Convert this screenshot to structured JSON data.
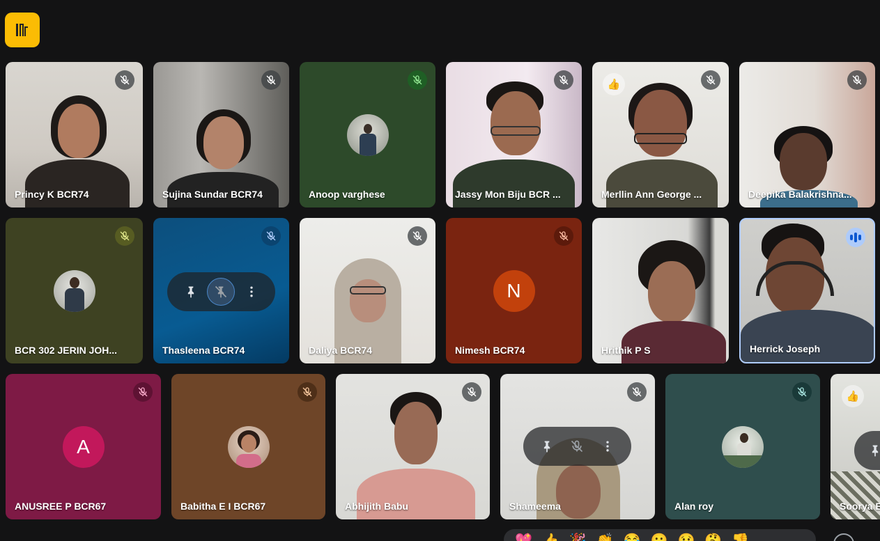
{
  "participants": [
    {
      "name": "Princy K BCR74"
    },
    {
      "name": "Sujina Sundar BCR74"
    },
    {
      "name": "Anoop varghese"
    },
    {
      "name": "Jassy Mon Biju BCR ..."
    },
    {
      "name": "Merllin Ann George ..."
    },
    {
      "name": "Deepika Balakrishna..."
    },
    {
      "name": "BCR 302 JERIN JOH..."
    },
    {
      "name": "Thasleena BCR74"
    },
    {
      "name": "Daliya BCR74"
    },
    {
      "name": "Nimesh BCR74",
      "initial": "N"
    },
    {
      "name": "Hrithik P S"
    },
    {
      "name": "Herrick Joseph"
    },
    {
      "name": "ANUSREE P BCR67",
      "initial": "A"
    },
    {
      "name": "Babitha E I BCR67"
    },
    {
      "name": "Abhijith Babu"
    },
    {
      "name": "Shameema"
    },
    {
      "name": "Alan roy"
    },
    {
      "name": "Soorya B"
    }
  ],
  "reactions": [
    "💖",
    "👍",
    "🎉",
    "👏",
    "😂",
    "😮",
    "😢",
    "🤔",
    "👎"
  ],
  "colors": {
    "accent_yellow": "#fbbc04",
    "speaking_blue": "#aecbfa",
    "highlight_border": "#aecbfa"
  },
  "icons": {
    "mic_off": "mic-off-icon",
    "pin": "pin-icon",
    "more": "more-vert-icon",
    "thumbs_up": "thumbs-up-icon",
    "exit": "exit-icon"
  }
}
